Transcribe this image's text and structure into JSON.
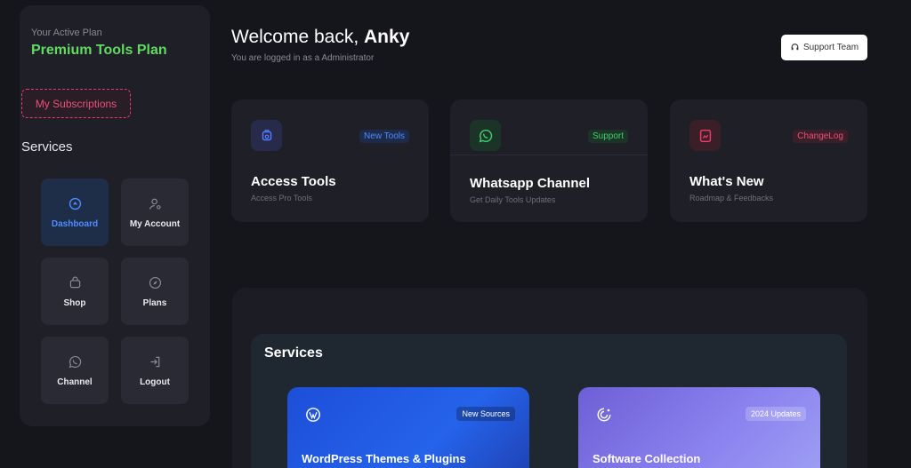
{
  "sidebar": {
    "plan_label": "Your Active Plan",
    "plan_name": "Premium Tools Plan",
    "subscriptions_button": "My Subscriptions",
    "services_title": "Services",
    "items": [
      {
        "label": "Dashboard",
        "icon": "dashboard-icon"
      },
      {
        "label": "My Account",
        "icon": "user-settings-icon"
      },
      {
        "label": "Shop",
        "icon": "shopping-bag-icon"
      },
      {
        "label": "Plans",
        "icon": "compass-icon"
      },
      {
        "label": "Channel",
        "icon": "whatsapp-icon"
      },
      {
        "label": "Logout",
        "icon": "logout-icon"
      }
    ]
  },
  "header": {
    "welcome_prefix": "Welcome back,",
    "user_name": "Anky",
    "logged_in_text": "You are logged in as a Administrator",
    "support_button": "Support Team"
  },
  "cards": [
    {
      "title": "Access Tools",
      "subtitle": "Access Pro Tools",
      "badge": "New Tools",
      "icon": "tools-icon",
      "color": "#4e7bff"
    },
    {
      "title": "Whatsapp Channel",
      "subtitle": "Get Daily Tools Updates",
      "badge": "Support",
      "icon": "whatsapp-icon",
      "color": "#3fcf6a"
    },
    {
      "title": "What's New",
      "subtitle": "Roadmap & Feedbacks",
      "badge": "ChangeLog",
      "icon": "changelog-icon",
      "color": "#ef3c6a"
    }
  ],
  "services": {
    "title": "Services",
    "items": [
      {
        "title": "WordPress Themes & Plugins",
        "badge": "New Sources",
        "icon": "wordpress-icon"
      },
      {
        "title": "Software Collection",
        "badge": "2024 Updates",
        "icon": "software-icon"
      }
    ]
  },
  "colors": {
    "accent_green": "#5fdc5f",
    "accent_pink": "#ef4d7a",
    "accent_blue": "#4e8bff"
  }
}
